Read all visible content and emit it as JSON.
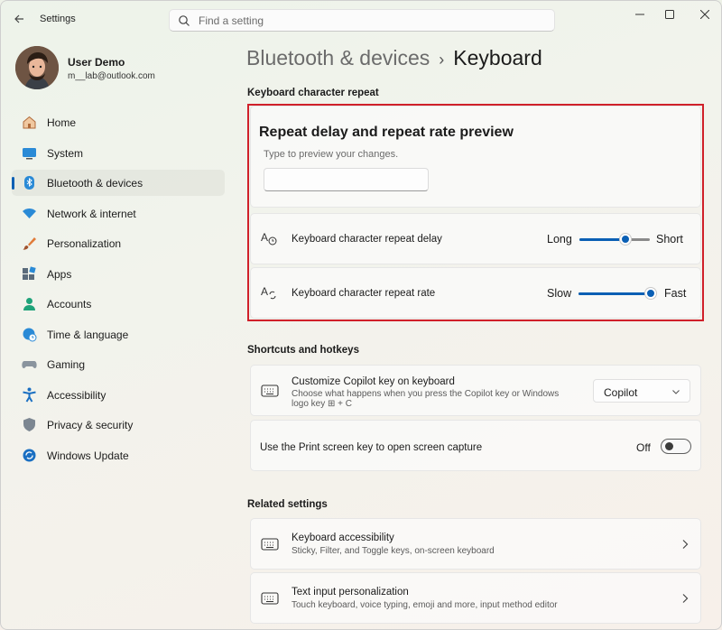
{
  "window": {
    "title": "Settings",
    "search_placeholder": "Find a setting",
    "icons": {
      "back": "back-arrow-icon",
      "search": "search-icon",
      "minimize": "minimize-icon",
      "maximize": "maximize-icon",
      "close": "close-icon"
    }
  },
  "user": {
    "name": "User Demo",
    "email": "m__lab@outlook.com"
  },
  "sidebar": {
    "items": [
      {
        "label": "Home",
        "icon": "home-icon"
      },
      {
        "label": "System",
        "icon": "system-icon"
      },
      {
        "label": "Bluetooth & devices",
        "icon": "bluetooth-icon",
        "active": true
      },
      {
        "label": "Network & internet",
        "icon": "wifi-icon"
      },
      {
        "label": "Personalization",
        "icon": "brush-icon"
      },
      {
        "label": "Apps",
        "icon": "apps-icon"
      },
      {
        "label": "Accounts",
        "icon": "accounts-icon"
      },
      {
        "label": "Time & language",
        "icon": "globe-clock-icon"
      },
      {
        "label": "Gaming",
        "icon": "gamepad-icon"
      },
      {
        "label": "Accessibility",
        "icon": "accessibility-icon"
      },
      {
        "label": "Privacy & security",
        "icon": "shield-icon"
      },
      {
        "label": "Windows Update",
        "icon": "update-icon"
      }
    ]
  },
  "breadcrumb": {
    "parent": "Bluetooth & devices",
    "separator": "›",
    "current": "Keyboard"
  },
  "repeat_section": {
    "title": "Keyboard character repeat",
    "preview_title": "Repeat delay and repeat rate preview",
    "preview_hint": "Type to preview your changes.",
    "preview_value": "",
    "delay": {
      "label": "Keyboard character repeat delay",
      "min_label": "Long",
      "max_label": "Short",
      "value_fraction": 0.65
    },
    "rate": {
      "label": "Keyboard character repeat rate",
      "min_label": "Slow",
      "max_label": "Fast",
      "value_fraction": 1.0
    }
  },
  "shortcuts_section": {
    "title": "Shortcuts and hotkeys",
    "copilot": {
      "label": "Customize Copilot key on keyboard",
      "desc_line1": "Choose what happens when you press the Copilot key or Windows",
      "desc_line2": "logo key ⊞ + C",
      "value": "Copilot"
    },
    "print_screen": {
      "label": "Use the Print screen key to open screen capture",
      "state": "Off"
    }
  },
  "related_section": {
    "title": "Related settings",
    "items": [
      {
        "label": "Keyboard accessibility",
        "desc": "Sticky, Filter, and Toggle keys, on-screen keyboard"
      },
      {
        "label": "Text input personalization",
        "desc": "Touch keyboard, voice typing, emoji and more, input method editor"
      }
    ]
  },
  "colors": {
    "accent": "#0a5fb4",
    "highlight_border": "#d0202a"
  }
}
